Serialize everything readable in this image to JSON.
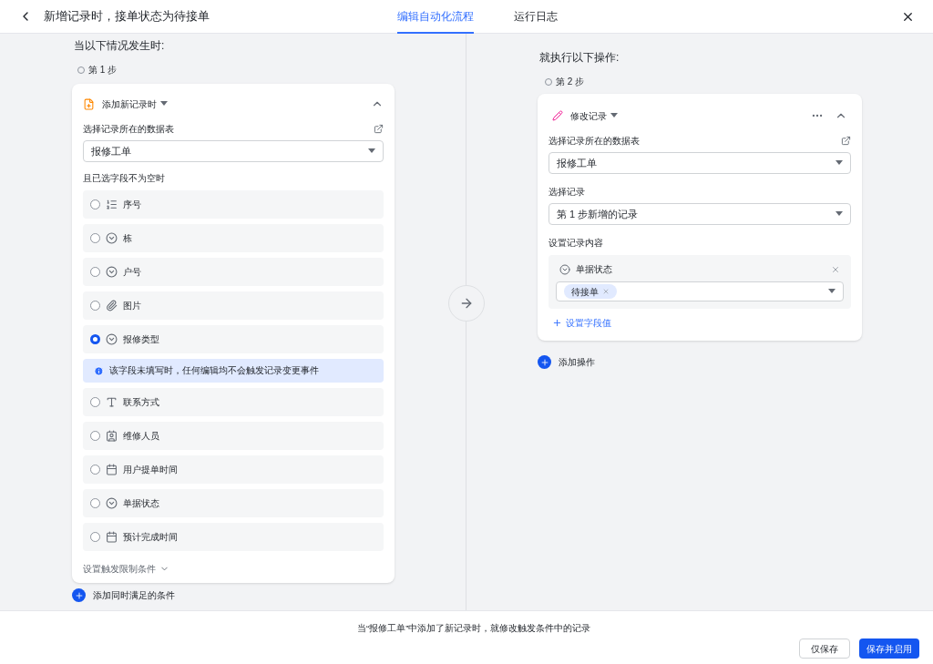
{
  "header": {
    "title": "新增记录时，接单状态为待接单",
    "tabs": [
      {
        "label": "编辑自动化流程",
        "selected": true
      },
      {
        "label": "运行日志",
        "selected": false
      }
    ]
  },
  "trigger": {
    "heading": "当以下情况发生时:",
    "step": "第 1 步",
    "card": {
      "title": "添加新记录时",
      "table_label": "选择记录所在的数据表",
      "table_value": "报修工单",
      "fields_label": "且已选字段不为空时",
      "fields": [
        {
          "kind": "number",
          "label": "序号",
          "selected": false
        },
        {
          "kind": "option",
          "label": "栋",
          "selected": false
        },
        {
          "kind": "option",
          "label": "户号",
          "selected": false
        },
        {
          "kind": "attachment",
          "label": "图片",
          "selected": false
        },
        {
          "kind": "option",
          "label": "报修类型",
          "selected": true,
          "note": "该字段未填写时，任何编辑均不会触发记录变更事件"
        },
        {
          "kind": "text",
          "label": "联系方式",
          "selected": false
        },
        {
          "kind": "person",
          "label": "维修人员",
          "selected": false
        },
        {
          "kind": "date",
          "label": "用户提单时间",
          "selected": false
        },
        {
          "kind": "option",
          "label": "单据状态",
          "selected": false
        },
        {
          "kind": "date",
          "label": "预计完成时间",
          "selected": false
        }
      ],
      "limit_link": "设置触发限制条件"
    },
    "add_condition": "添加同时满足的条件"
  },
  "action": {
    "heading": "就执行以下操作:",
    "step": "第 2 步",
    "card": {
      "title": "修改记录",
      "table_label": "选择记录所在的数据表",
      "table_value": "报修工单",
      "record_label": "选择记录",
      "record_value": "第 1 步新增的记录",
      "content_label": "设置记录内容",
      "field": {
        "label": "单据状态",
        "tags": [
          "待接单"
        ]
      },
      "add_value": "设置字段值"
    },
    "add_action": "添加操作"
  },
  "footer": {
    "summary": "当“报修工单”中添加了新记录时，就修改触发条件中的记录",
    "buttons": [
      {
        "label": "仅保存",
        "kind": "secondary"
      },
      {
        "label": "保存并启用",
        "kind": "primary"
      }
    ]
  }
}
